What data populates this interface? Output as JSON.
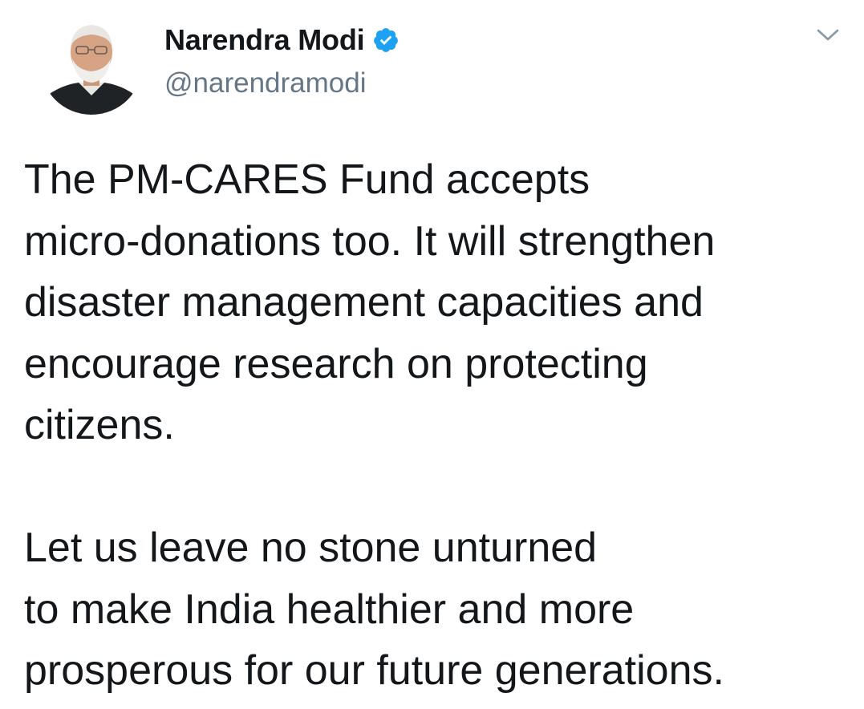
{
  "tweet": {
    "author": {
      "display_name": "Narendra Modi",
      "handle": "@narendramodi",
      "verified": true,
      "avatar": "profile-photo"
    },
    "menu_icon": "chevron-down-icon",
    "text_lines": [
      "The PM-CARES Fund accepts",
      "micro-donations too. It will strengthen",
      "disaster management capacities and",
      "encourage research on protecting",
      "citizens.",
      "",
      "Let us leave no stone unturned",
      "to make India healthier and more",
      "prosperous for our future generations."
    ]
  },
  "colors": {
    "text": "#14171a",
    "secondary_text": "#657786",
    "verified_blue": "#1da1f2",
    "background": "#ffffff"
  }
}
